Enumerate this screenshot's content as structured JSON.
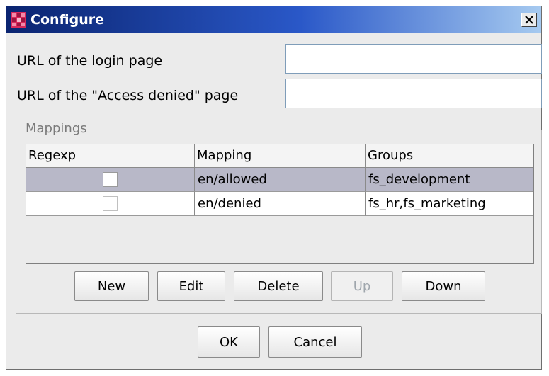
{
  "window": {
    "title": "Configure",
    "close_glyph": "✕"
  },
  "form": {
    "login_label": "URL of the login page",
    "login_value": "",
    "denied_label": "URL of the \"Access denied\" page",
    "denied_value": ""
  },
  "mappings": {
    "legend": "Mappings",
    "columns": [
      "Regexp",
      "Mapping",
      "Groups"
    ],
    "rows": [
      {
        "regexp": false,
        "mapping": "en/allowed",
        "groups": "fs_development",
        "selected": true
      },
      {
        "regexp": false,
        "mapping": "en/denied",
        "groups": "fs_hr,fs_marketing",
        "selected": false
      }
    ],
    "buttons": {
      "new": "New",
      "edit": "Edit",
      "delete": "Delete",
      "up": "Up",
      "down": "Down"
    }
  },
  "footer": {
    "ok": "OK",
    "cancel": "Cancel"
  },
  "colors": {
    "titlebar_start": "#0a2470",
    "titlebar_end": "#a6caf0",
    "selected_row": "#b8b8c8",
    "disabled_text": "#9fa6ad"
  },
  "icons": {
    "app": "app-grid-icon",
    "close": "close-icon"
  }
}
